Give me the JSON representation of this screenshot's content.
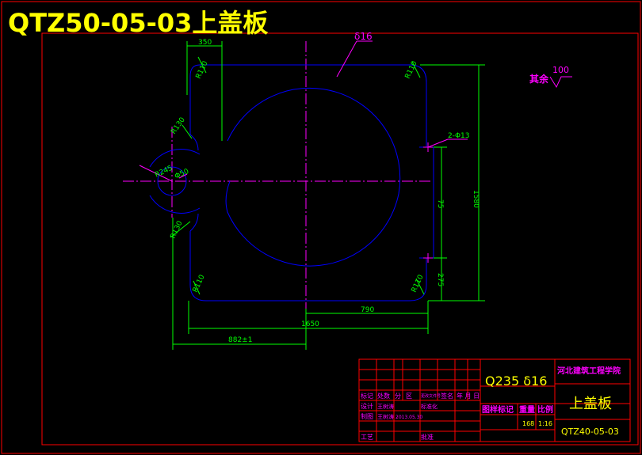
{
  "title": "QTZ50-05-03上盖板",
  "colors": {
    "background": "#000000",
    "frame": "#ff0000",
    "part_outline": "#0000ff",
    "centerline": "#ff00ff",
    "dimension": "#00ff00",
    "leader": "#ff00ff",
    "title_block_text": "#ffff00"
  },
  "dimensions": {
    "d350": "350",
    "r110_top_left": "R110",
    "r110_top_right": "R110",
    "r130_upper": "R130",
    "r130_lower": "R130",
    "r245": "R245",
    "d50": "Φ50",
    "r110_bottom_left": "R110",
    "r110_bottom_right": "R110",
    "d790": "790",
    "d1650": "1650",
    "d882": "882±1",
    "d1580": "1580",
    "d75": "75",
    "d275": "275",
    "hole_callout": "2-Φ13"
  },
  "annotations": {
    "thickness": "δ16",
    "other_label": "其余",
    "other_value": "100"
  },
  "title_block": {
    "material": "Q235 δ16",
    "school": "河北建筑工程学院",
    "part_name": "上盖板",
    "drawing_no": "QTZ40-05-03",
    "mark_row": [
      "标记",
      "处数",
      "分",
      "区",
      "更改文件号",
      "签名",
      "年 月 日"
    ],
    "designer_label": "设计",
    "designer_name": "王树涛",
    "std_label": "标准化",
    "drafter_label": "制图",
    "drafter_name": "王树涛",
    "date": "2013.05.30",
    "process_label": "工艺",
    "approve_label": "批准",
    "stage_label": "图样标记",
    "weight_label": "重量",
    "scale_label": "比例",
    "weight_value": "168",
    "scale_value": "1:16"
  }
}
